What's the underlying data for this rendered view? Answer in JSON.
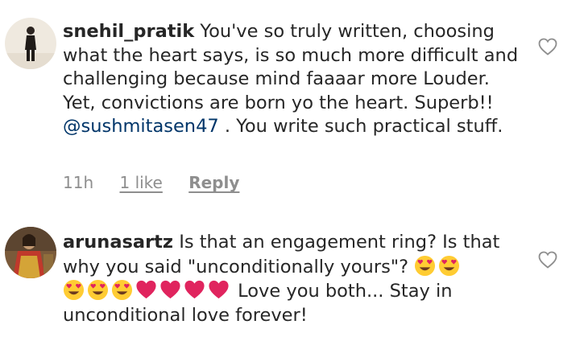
{
  "comments": [
    {
      "username": "snehil_pratik",
      "text_before_mention": "You've so truly written, choosing what the heart says, is so much more difficult and challenging because mind faaaar more Louder. Yet, convictions are born yo the heart. Superb!! ",
      "mention": "@sushmitasen47",
      "text_after_mention": " . You write such practical stuff.",
      "time": "11h",
      "likes": "1 like",
      "reply": "Reply",
      "icon": "heart-outline-icon"
    },
    {
      "username": "arunasartz",
      "text_part1": "Is that an engagement ring? Is that why you said \"unconditionally yours\"?",
      "text_part2": "Love you both... Stay in unconditional love forever!",
      "emojis": [
        "heart-eyes-emoji",
        "heart-eyes-emoji",
        "heart-eyes-emoji",
        "heart-eyes-emoji",
        "heart-eyes-emoji",
        "red-heart-emoji",
        "red-heart-emoji",
        "red-heart-emoji",
        "red-heart-emoji"
      ],
      "icon": "heart-outline-icon"
    }
  ],
  "colors": {
    "text": "#262626",
    "secondary": "#8e8e8e",
    "mention": "#003569",
    "heart_emoji": "#e0245e",
    "face_emoji": "#ffcc33"
  }
}
